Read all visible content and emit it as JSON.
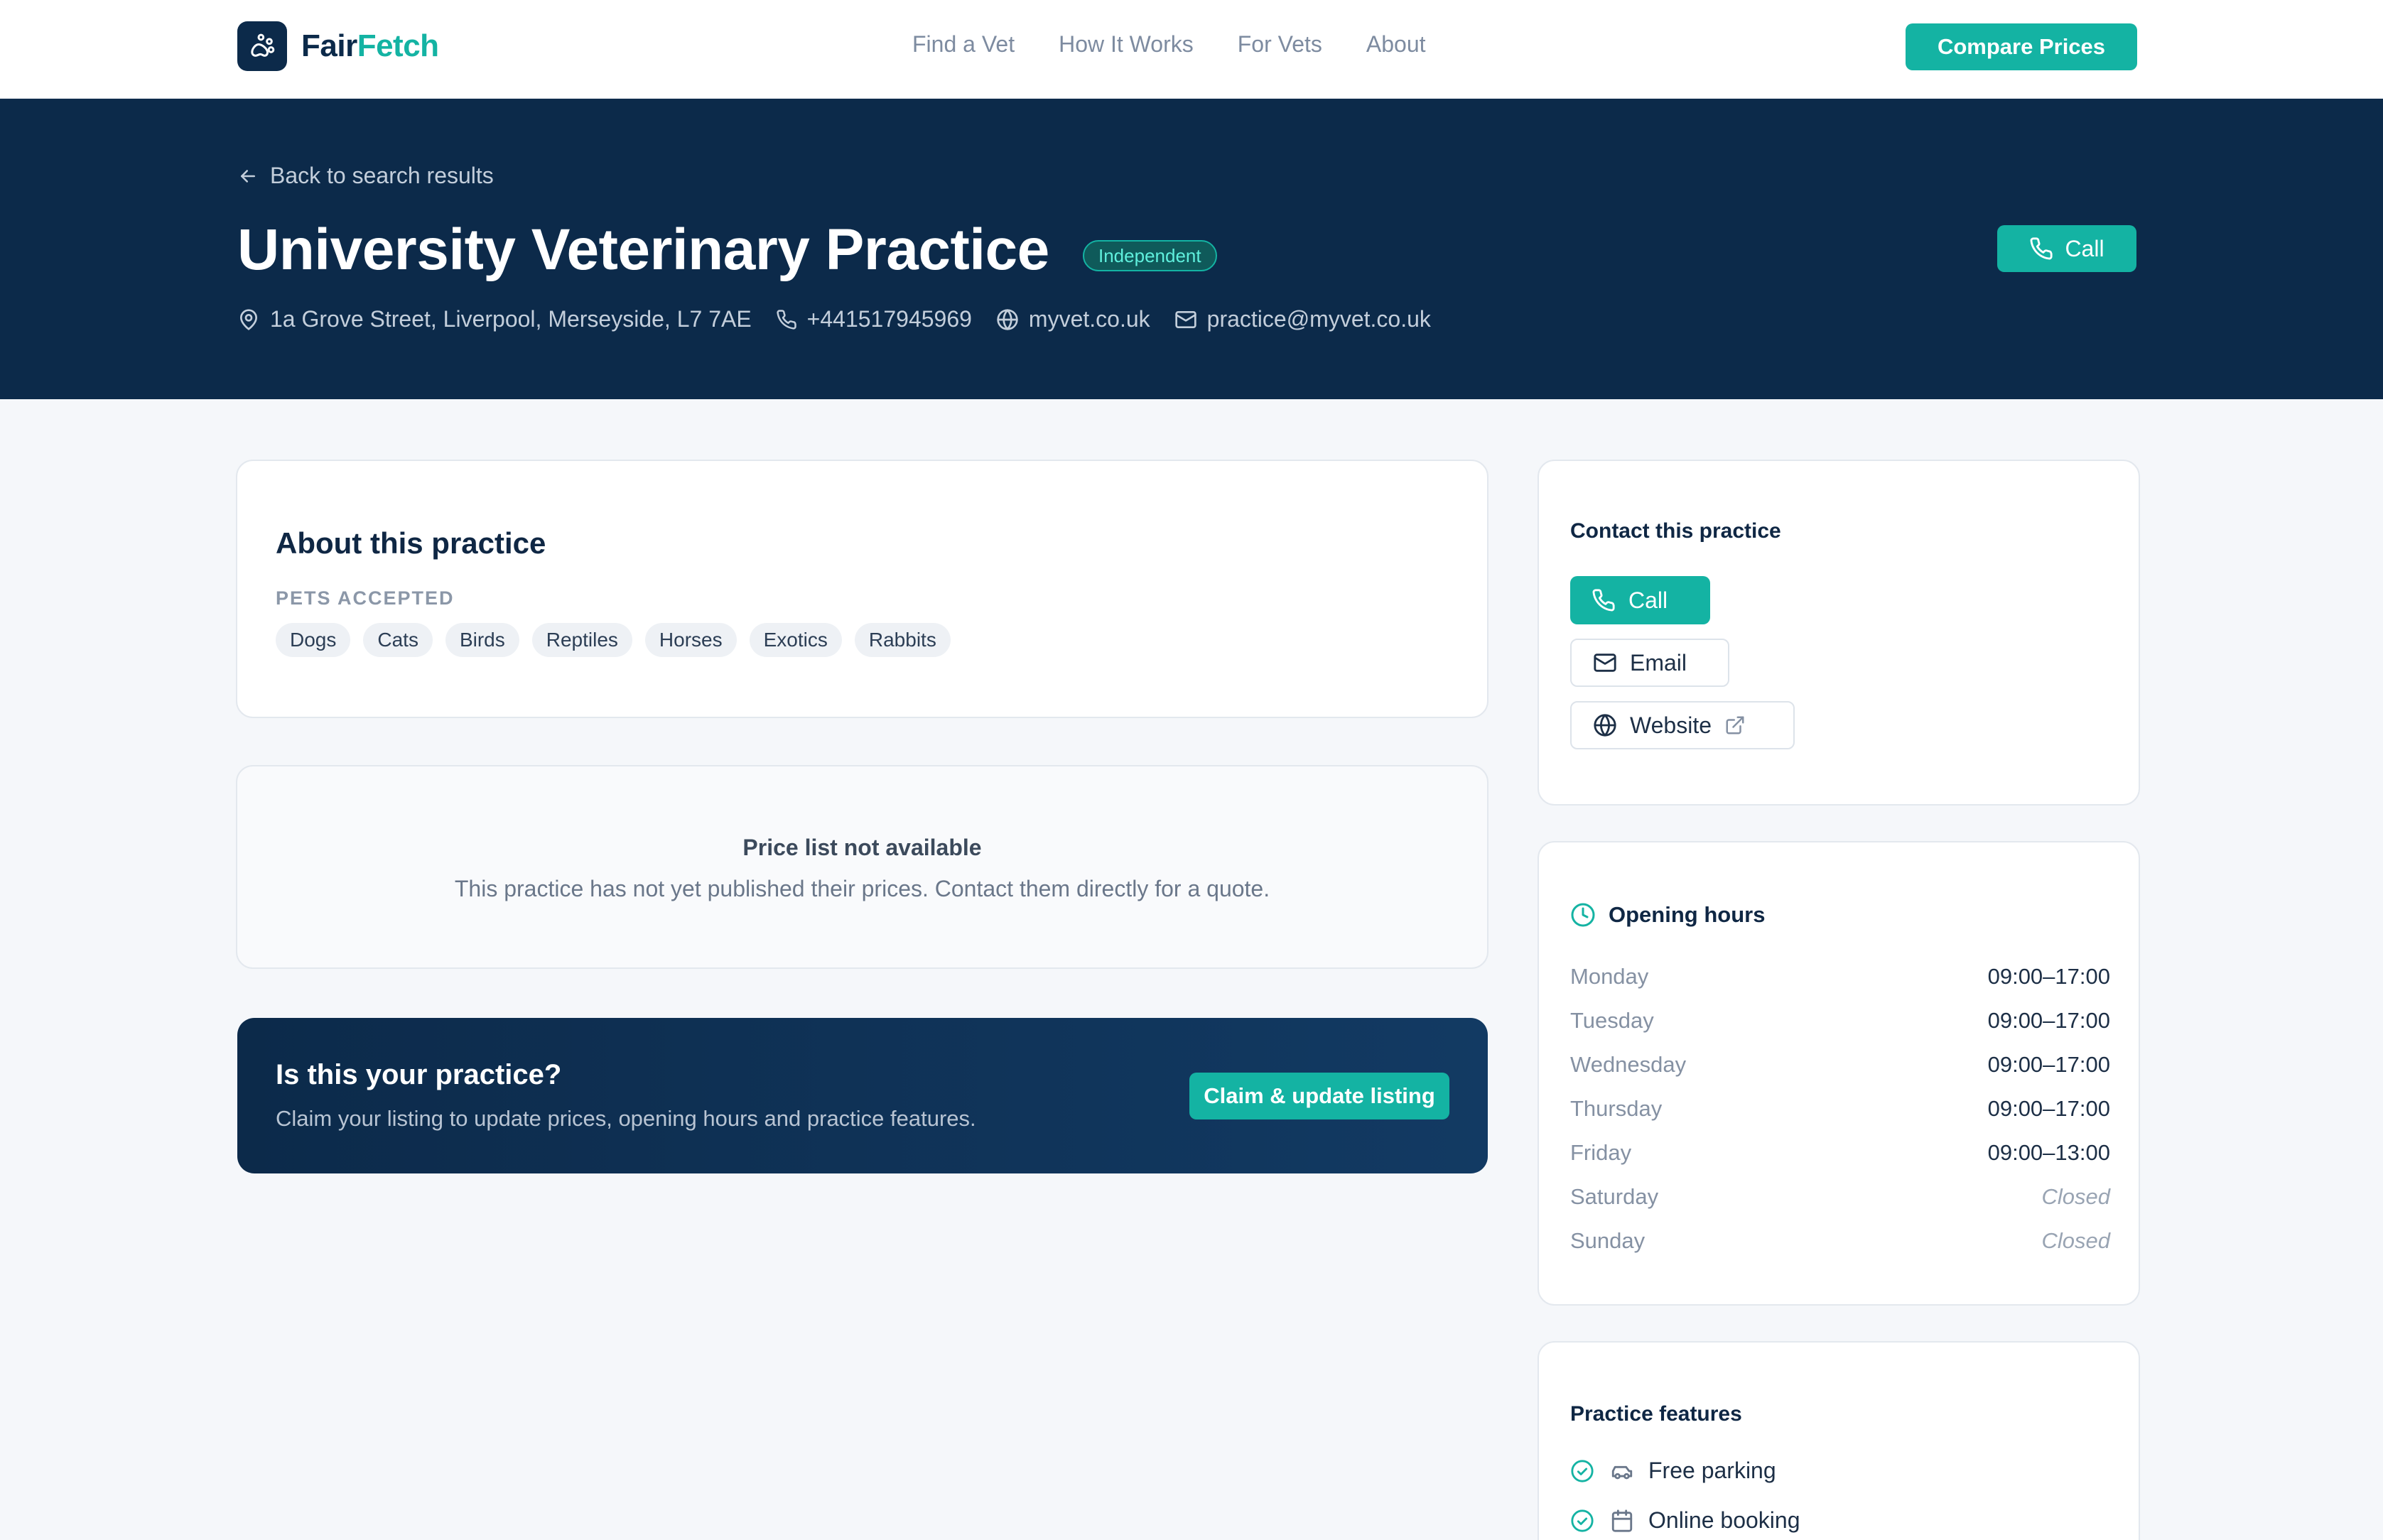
{
  "brand": {
    "part1": "Fair",
    "part2": "Fetch",
    "accent": "#14b3a3",
    "navy": "#0c2a4a"
  },
  "nav": {
    "links": [
      "Find a Vet",
      "How It Works",
      "For Vets",
      "About"
    ],
    "cta": "Compare Prices"
  },
  "hero": {
    "back_label": "Back to search results",
    "title": "University Veterinary Practice",
    "badge": "Independent",
    "call_label": "Call",
    "address": "1a Grove Street, Liverpool, Merseyside, L7 7AE",
    "phone": "+441517945969",
    "website": "myvet.co.uk",
    "email": "practice@myvet.co.uk"
  },
  "about": {
    "title": "About this practice",
    "pets_label": "PETS ACCEPTED",
    "pets": [
      "Dogs",
      "Cats",
      "Birds",
      "Reptiles",
      "Horses",
      "Exotics",
      "Rabbits"
    ]
  },
  "price": {
    "title": "Price list not available",
    "subtitle": "This practice has not yet published their prices. Contact them directly for a quote."
  },
  "claim": {
    "title": "Is this your practice?",
    "subtitle": "Claim your listing to update prices, opening hours and practice features.",
    "button": "Claim & update listing"
  },
  "contact": {
    "title": "Contact this practice",
    "call": "Call",
    "email": "Email",
    "website": "Website"
  },
  "hours": {
    "title": "Opening hours",
    "days": [
      {
        "day": "Monday",
        "time": "09:00–17:00",
        "closed": false
      },
      {
        "day": "Tuesday",
        "time": "09:00–17:00",
        "closed": false
      },
      {
        "day": "Wednesday",
        "time": "09:00–17:00",
        "closed": false
      },
      {
        "day": "Thursday",
        "time": "09:00–17:00",
        "closed": false
      },
      {
        "day": "Friday",
        "time": "09:00–13:00",
        "closed": false
      },
      {
        "day": "Saturday",
        "time": "Closed",
        "closed": true
      },
      {
        "day": "Sunday",
        "time": "Closed",
        "closed": true
      }
    ]
  },
  "features": {
    "title": "Practice features",
    "items": [
      {
        "label": "Free parking",
        "icon": "car-icon"
      },
      {
        "label": "Online booking",
        "icon": "calendar-icon"
      }
    ]
  }
}
